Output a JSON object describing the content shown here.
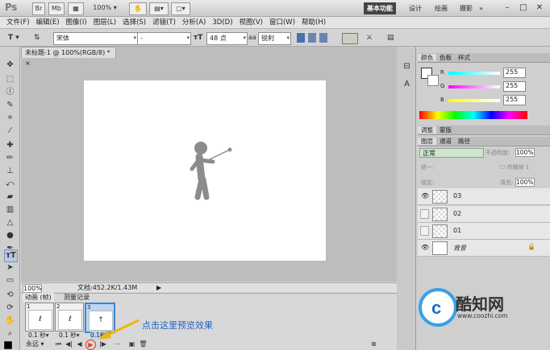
{
  "titlebar": {
    "app_logo": "Ps",
    "btn_mb": "Mb",
    "zoom": "100%",
    "workspaces": [
      "基本功能",
      "设计",
      "绘画",
      "摄影"
    ],
    "active_workspace": "基本功能",
    "workspace_more": "»"
  },
  "menubar": {
    "items": [
      "文件(F)",
      "编辑(E)",
      "图像(I)",
      "图层(L)",
      "选择(S)",
      "滤镜(T)",
      "分析(A)",
      "3D(D)",
      "视图(V)",
      "窗口(W)",
      "帮助(H)"
    ]
  },
  "options": {
    "tool_glyph": "T",
    "font_family": "宋体",
    "font_style": "-",
    "font_size": "48 点",
    "aa_label": "a",
    "antialias": "锐利",
    "swatch_color": "#c8d1c0"
  },
  "document": {
    "tab_title": "未标题-1 @ 100%(RGB/8) *",
    "zoom_status": "100%",
    "doc_info": "文档:452.2K/1.43M",
    "figure_color": "#8c8c8c"
  },
  "animation": {
    "tabs": [
      "动画 (帧)",
      "测量记录"
    ],
    "frames": [
      {
        "num": "1",
        "delay": "0.1 秒▾"
      },
      {
        "num": "2",
        "delay": "0.1 秒▾"
      },
      {
        "num": "3",
        "delay": "0.1秒"
      }
    ],
    "loop": "永远",
    "annotation": "点击这里预览效果"
  },
  "color_panel": {
    "tabs": [
      "颜色",
      "色板",
      "样式"
    ],
    "channels": [
      {
        "label": "R",
        "value": "255"
      },
      {
        "label": "G",
        "value": "255"
      },
      {
        "label": "B",
        "value": "255"
      }
    ]
  },
  "adjust_panel": {
    "tabs": [
      "调整",
      "蒙版"
    ]
  },
  "layers_panel": {
    "tabs": [
      "图层",
      "通道",
      "路径"
    ],
    "blend_mode": "正常",
    "opacity_label": "不透明度:",
    "opacity_value": "100%",
    "unify_label": "统一:",
    "propagate_label": "传播帧 1",
    "lock_label": "锁定:",
    "fill_label": "填充:",
    "fill_value": "100%",
    "layers": [
      {
        "name": "03",
        "visible": true
      },
      {
        "name": "02",
        "visible": false
      },
      {
        "name": "01",
        "visible": false
      },
      {
        "name": "背景",
        "visible": true
      }
    ]
  },
  "watermark": {
    "brand": "酷知网",
    "url": "www.coozhi.com"
  }
}
